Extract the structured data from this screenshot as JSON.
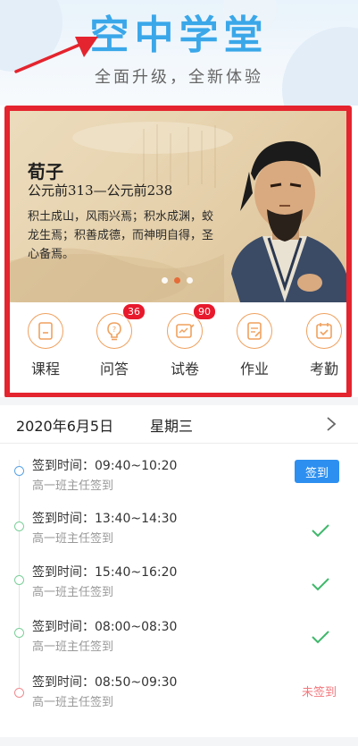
{
  "header": {
    "title": "空中学堂",
    "subtitle": "全面升级，全新体验"
  },
  "banner": {
    "name": "荀子",
    "era": "公元前313—公元前238",
    "quote": "积土成山，风雨兴焉；积水成渊，蛟龙生焉；积善成德，而神明自得，圣心备焉。",
    "active_slide": 2,
    "slide_count": 3
  },
  "menu": {
    "items": [
      {
        "label": "课程",
        "icon": "course-icon"
      },
      {
        "label": "问答",
        "icon": "question-bulb-icon",
        "badge": "36"
      },
      {
        "label": "试卷",
        "icon": "exam-paper-icon",
        "badge": "90"
      },
      {
        "label": "作业",
        "icon": "homework-icon"
      },
      {
        "label": "考勤",
        "icon": "attendance-calendar-icon"
      }
    ]
  },
  "date_bar": {
    "date": "2020年6月5日",
    "weekday": "星期三"
  },
  "attendance": [
    {
      "time": "签到时间：09:40~10:20",
      "teacher": "高一班主任签到",
      "status": "button",
      "action_label": "签到",
      "node_color": "#5aa3e6"
    },
    {
      "time": "签到时间：13:40~14:30",
      "teacher": "高一班主任签到",
      "status": "done",
      "node_color": "#7ccf9a"
    },
    {
      "time": "签到时间：15:40~16:20",
      "teacher": "高一班主任签到",
      "status": "done",
      "node_color": "#7ccf9a"
    },
    {
      "time": "签到时间：08:00~08:30",
      "teacher": "高一班主任签到",
      "status": "done",
      "node_color": "#7ccf9a"
    },
    {
      "time": "签到时间：08:50~09:30",
      "teacher": "高一班主任签到",
      "status": "missed",
      "status_label": "未签到",
      "node_color": "#f08a8f"
    }
  ],
  "colors": {
    "accent": "#3aa7e9",
    "highlight_frame": "#e4242e",
    "button": "#2d8ff0",
    "check": "#3fb86b",
    "missed": "#f2787d",
    "icon_ring": "#f0a15f"
  }
}
